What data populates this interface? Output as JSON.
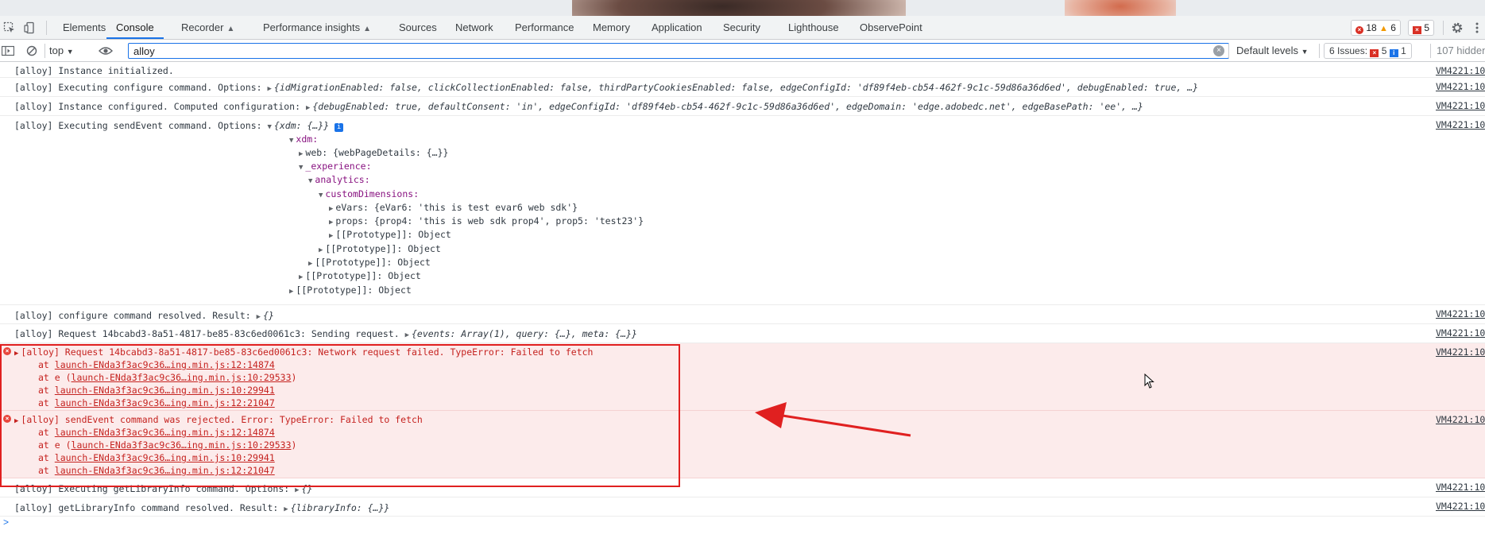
{
  "tabs": [
    "Elements",
    "Console",
    "Recorder",
    "Performance insights",
    "Sources",
    "Network",
    "Performance",
    "Memory",
    "Application",
    "Security",
    "Lighthouse",
    "ObservePoint"
  ],
  "counts": {
    "errors": "18",
    "warnings": "6",
    "issues": "5"
  },
  "filter": {
    "context": "top",
    "value": "alloy",
    "levels": "Default levels",
    "issues_label": "6 Issues:",
    "issues_errors": "5",
    "issues_info": "1",
    "hidden": "107 hidden"
  },
  "source": "VM4221:10",
  "messages": {
    "m1": "[alloy] Instance initialized.",
    "m2_prefix": "[alloy] Executing configure command. Options: ",
    "m2_obj": "{idMigrationEnabled: false, clickCollectionEnabled: false, thirdPartyCookiesEnabled: false, edgeConfigId: 'df89f4eb-cb54-462f-9c1c-59d86a36d6ed', debugEnabled: true, …}",
    "m3_prefix": "[alloy] Instance configured. Computed configuration: ",
    "m3_obj": "{debugEnabled: true, defaultConsent: 'in', edgeConfigId: 'df89f4eb-cb54-462f-9c1c-59d86a36d6ed', edgeDomain: 'edge.adobedc.net', edgeBasePath: 'ee', …}",
    "m4_prefix": "[alloy] Executing sendEvent command. Options: ",
    "m4_obj": "{xdm: {…}}",
    "tree": [
      "xdm:",
      "web: {webPageDetails: {…}}",
      "_experience:",
      "analytics:",
      "customDimensions:",
      "eVars: {eVar6: 'this is test evar6 web sdk'}",
      "props: {prop4: 'this is web sdk prop4', prop5: 'test23'}",
      "[[Prototype]]: Object",
      "[[Prototype]]: Object",
      "[[Prototype]]: Object",
      "[[Prototype]]: Object",
      "[[Prototype]]: Object"
    ],
    "m5_prefix": "[alloy] configure command resolved. Result: ",
    "m5_obj": "{}",
    "m6_prefix": "[alloy] Request 14bcabd3-8a51-4817-be85-83c6ed0061c3: Sending request. ",
    "m6_obj": "{events: Array(1), query: {…}, meta: {…}}",
    "e1": "[alloy] Request 14bcabd3-8a51-4817-be85-83c6ed0061c3: Network request failed. TypeError: Failed to fetch",
    "e2": "[alloy] sendEvent command was rejected. Error: TypeError: Failed to fetch",
    "stack_at": "at",
    "stack_e": "at e (",
    "stack_close": ")",
    "stack1": "launch-ENda3f3ac9c36…ing.min.js:12:14874",
    "stack2": "launch-ENda3f3ac9c36…ing.min.js:10:29533",
    "stack3": "launch-ENda3f3ac9c36…ing.min.js:10:29941",
    "stack4": "launch-ENda3f3ac9c36…ing.min.js:12:21047",
    "m7_prefix": "[alloy] Executing getLibraryInfo command. Options: ",
    "m7_obj": "{}",
    "m8_prefix": "[alloy] getLibraryInfo command resolved. Result: ",
    "m8_obj": "{libraryInfo: {…}}"
  },
  "colors": {
    "accent": "#1a73e8",
    "error_bg": "#fcebeb",
    "error_text": "#c5221f",
    "annotation": "#e02020"
  },
  "icons": [
    "inspect-icon",
    "device-toggle-icon",
    "flask-icon",
    "gear-icon",
    "more-icon",
    "sidebar-icon",
    "clear-console-icon",
    "eye-icon",
    "error-icon",
    "warning-icon",
    "info-icon",
    "expand-triangle-icon",
    "arrow-annotation"
  ]
}
